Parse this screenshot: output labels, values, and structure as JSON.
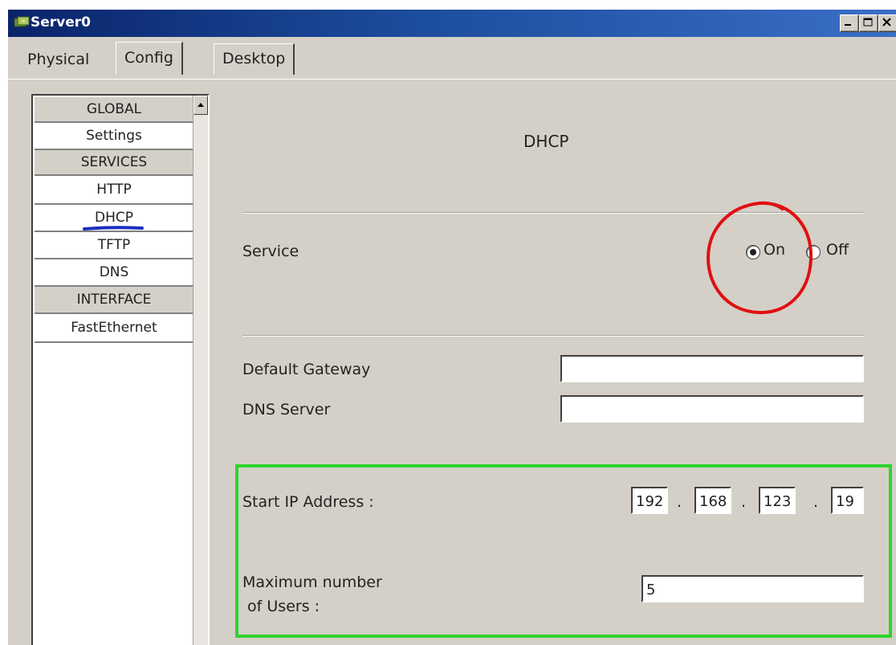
{
  "window": {
    "title": "Server0"
  },
  "tabs": [
    {
      "label": "Physical",
      "active": false
    },
    {
      "label": "Config",
      "active": true
    },
    {
      "label": "Desktop",
      "active": false
    }
  ],
  "sidebar": {
    "items": [
      {
        "label": "GLOBAL",
        "kind": "header"
      },
      {
        "label": "Settings",
        "kind": "item"
      },
      {
        "label": "SERVICES",
        "kind": "header"
      },
      {
        "label": "HTTP",
        "kind": "item"
      },
      {
        "label": "DHCP",
        "kind": "item",
        "selected": true
      },
      {
        "label": "TFTP",
        "kind": "item"
      },
      {
        "label": "DNS",
        "kind": "item"
      },
      {
        "label": "INTERFACE",
        "kind": "header"
      },
      {
        "label": "FastEthernet",
        "kind": "item"
      }
    ]
  },
  "dhcp": {
    "heading": "DHCP",
    "service_label": "Service",
    "on_label": "On",
    "off_label": "Off",
    "service_state": "On",
    "gateway_label": "Default Gateway",
    "gateway_value": "",
    "dns_label": "DNS Server",
    "dns_value": "",
    "start_ip_label": "Start IP Address :",
    "start_ip": [
      "192",
      "168",
      "123",
      "19"
    ],
    "ip_dot": ".",
    "max_users_label": "Maximum number\n of Users :",
    "max_users_value": "5"
  },
  "annotations": {
    "circle_color": "#e01010",
    "box_color": "#2fd42f",
    "underline_color": "#1a2fc0"
  },
  "colors": {
    "titlebar": "#0a246a",
    "face": "#d4d0c8"
  }
}
